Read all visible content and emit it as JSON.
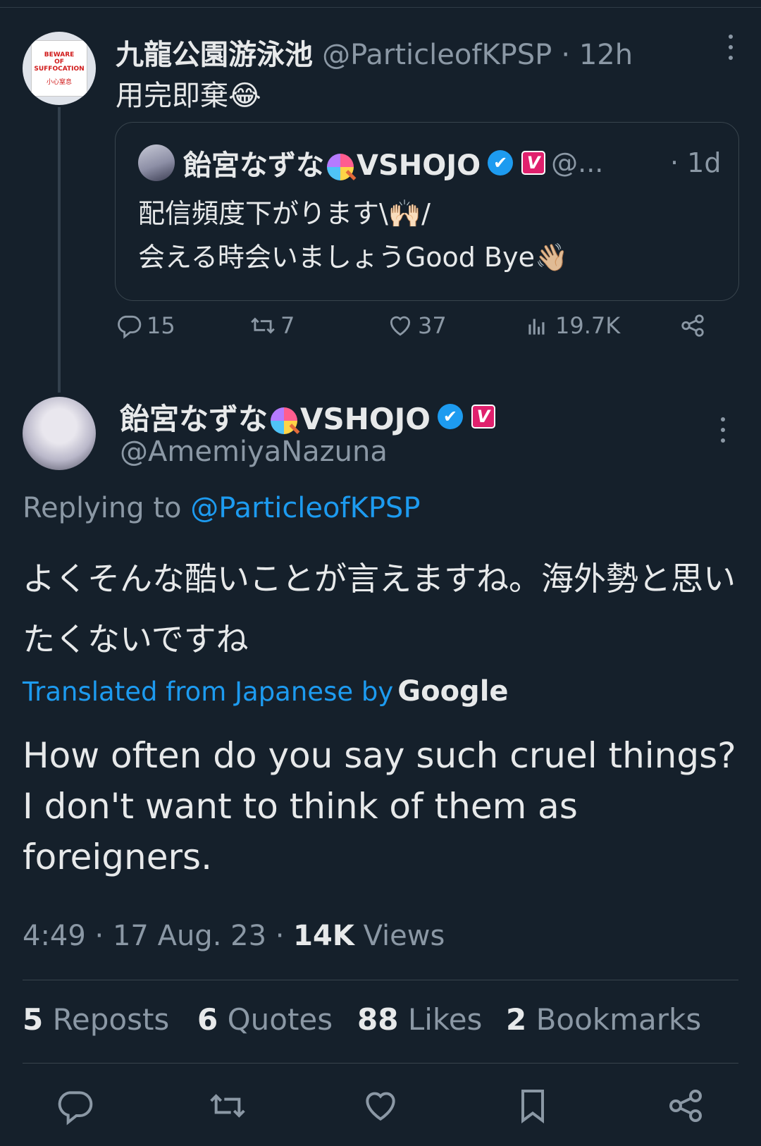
{
  "parent": {
    "avatar_sign_lines": [
      "BEWARE",
      "OF",
      "SUFFOCATION"
    ],
    "avatar_sign_chinese": "小心窒息",
    "name": "九龍公園游泳池",
    "handle": "@ParticleofKPSP",
    "time": "· 12h",
    "text": "用完即棄😂",
    "quote": {
      "name_part1": "飴宮なずな",
      "name_part2": "VSHOJO",
      "verified_icon": "✔",
      "vshojo_badge": "V",
      "handle": "@...",
      "time": "· 1d",
      "text_line1": "配信頻度下がります\\🙌🏻/",
      "text_line2": "会える時会いましょうGood Bye👋🏼"
    },
    "actions": {
      "replies": "15",
      "reposts": "7",
      "likes": "37",
      "views": "19.7K"
    }
  },
  "focal": {
    "name_part1": "飴宮なずな",
    "name_part2": "VSHOJO",
    "verified_icon": "✔",
    "vshojo_badge": "V",
    "handle": "@AmemiyaNazuna",
    "replying_prefix": "Replying to",
    "replying_handle": "@ParticleofKPSP",
    "text_ja": "よくそんな酷いことが言えますね。海外勢と思いたくないですね",
    "translated_label": "Translated from Japanese by",
    "translated_provider": "Google",
    "text_en": "How often do you say such cruel things? I don't want to think of them as foreigners.",
    "timestamp": "4:49 · 17 Aug. 23 ·",
    "views_count": "14K",
    "views_label": "Views",
    "stats": {
      "reposts_count": "5",
      "reposts_label": "Reposts",
      "quotes_count": "6",
      "quotes_label": "Quotes",
      "likes_count": "88",
      "likes_label": "Likes",
      "bookmarks_count": "2",
      "bookmarks_label": "Bookmarks"
    }
  },
  "colors": {
    "background": "#15202b",
    "text": "#e7e9ea",
    "muted": "#8b98a5",
    "link": "#1d9bf0",
    "vshojo": "#e0206d"
  },
  "icons": [
    "more-icon",
    "reply-icon",
    "repost-icon",
    "like-icon",
    "views-icon",
    "share-icon",
    "bookmark-icon",
    "verified-icon",
    "lollipop-icon"
  ]
}
